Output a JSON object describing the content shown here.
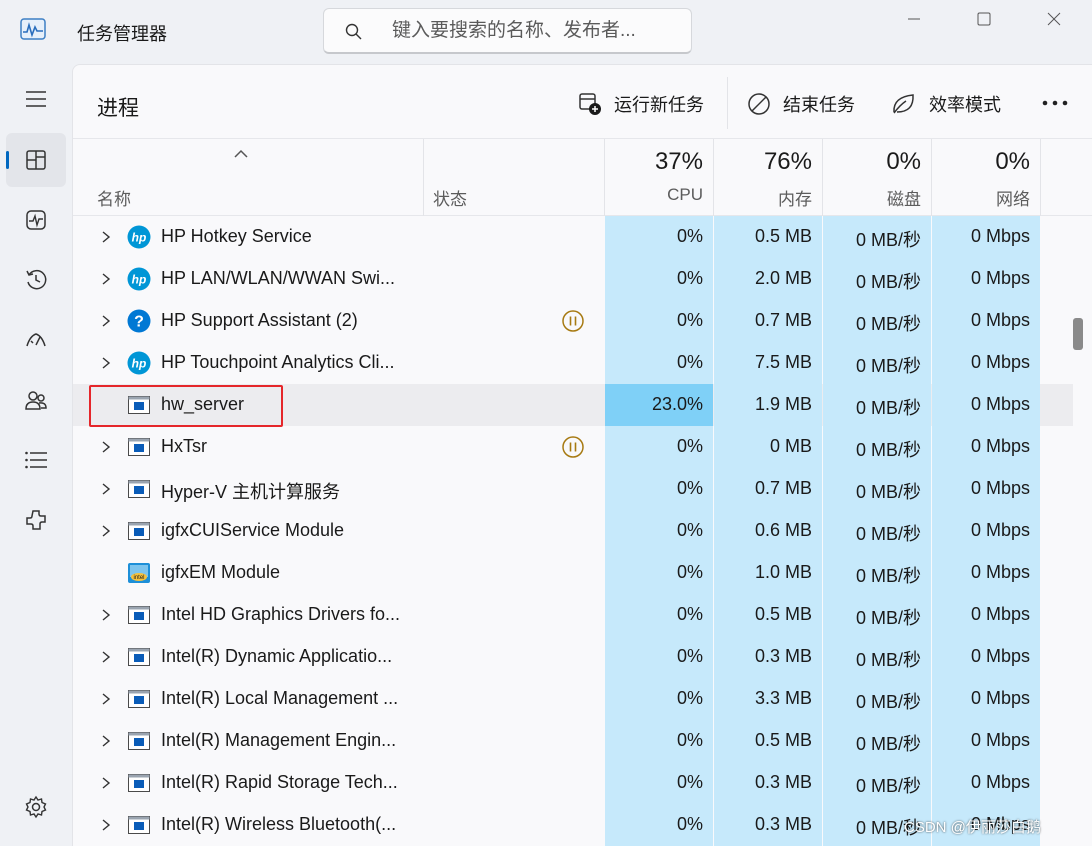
{
  "app": {
    "title": "任务管理器",
    "icon": "task-manager-icon"
  },
  "search": {
    "placeholder": "键入要搜索的名称、发布者..."
  },
  "window_controls": [
    "minimize-icon",
    "maximize-icon",
    "close-icon"
  ],
  "nav": [
    {
      "id": "menu",
      "icon": "hamburger-icon"
    },
    {
      "id": "processes",
      "icon": "processes-icon",
      "active": true
    },
    {
      "id": "performance",
      "icon": "performance-icon"
    },
    {
      "id": "app-history",
      "icon": "history-icon"
    },
    {
      "id": "startup",
      "icon": "startup-icon"
    },
    {
      "id": "users",
      "icon": "users-icon"
    },
    {
      "id": "details",
      "icon": "details-icon"
    },
    {
      "id": "services",
      "icon": "services-icon"
    },
    {
      "id": "settings",
      "icon": "settings-icon"
    }
  ],
  "page": {
    "title": "进程"
  },
  "commands": {
    "run_new_task": "运行新任务",
    "end_task": "结束任务",
    "efficiency_mode": "效率模式"
  },
  "columns": {
    "name": "名称",
    "status": "状态",
    "cpu": {
      "pct": "37%",
      "label": "CPU"
    },
    "memory": {
      "pct": "76%",
      "label": "内存"
    },
    "disk": {
      "pct": "0%",
      "label": "磁盘"
    },
    "network": {
      "pct": "0%",
      "label": "网络"
    }
  },
  "colors": {
    "metric_bg": "#c6e9fb",
    "metric_bg_hot": "#7fd0f7",
    "accent": "#0067c0",
    "highlight_border": "#e5262a"
  },
  "processes": [
    {
      "name": "HP Hotkey Service",
      "icon": "hp-logo-icon",
      "expandable": true,
      "status": "",
      "cpu": "0%",
      "memory": "0.5 MB",
      "disk": "0 MB/秒",
      "network": "0 Mbps"
    },
    {
      "name": "HP LAN/WLAN/WWAN Swi...",
      "icon": "hp-logo-icon",
      "expandable": true,
      "status": "",
      "cpu": "0%",
      "memory": "2.0 MB",
      "disk": "0 MB/秒",
      "network": "0 Mbps"
    },
    {
      "name": "HP Support Assistant (2)",
      "icon": "help-circle-icon",
      "expandable": true,
      "status": "paused",
      "cpu": "0%",
      "memory": "0.7 MB",
      "disk": "0 MB/秒",
      "network": "0 Mbps"
    },
    {
      "name": "HP Touchpoint Analytics Cli...",
      "icon": "hp-logo-icon",
      "expandable": true,
      "status": "",
      "cpu": "0%",
      "memory": "7.5 MB",
      "disk": "0 MB/秒",
      "network": "0 Mbps"
    },
    {
      "name": "hw_server",
      "icon": "app-window-icon",
      "expandable": false,
      "status": "",
      "cpu": "23.0%",
      "memory": "1.9 MB",
      "disk": "0 MB/秒",
      "network": "0 Mbps",
      "selected": true
    },
    {
      "name": "HxTsr",
      "icon": "app-window-icon",
      "expandable": true,
      "status": "paused",
      "cpu": "0%",
      "memory": "0 MB",
      "disk": "0 MB/秒",
      "network": "0 Mbps"
    },
    {
      "name": "Hyper-V 主机计算服务",
      "icon": "app-window-icon",
      "expandable": true,
      "status": "",
      "cpu": "0%",
      "memory": "0.7 MB",
      "disk": "0 MB/秒",
      "network": "0 Mbps"
    },
    {
      "name": "igfxCUIService Module",
      "icon": "app-window-icon",
      "expandable": true,
      "status": "",
      "cpu": "0%",
      "memory": "0.6 MB",
      "disk": "0 MB/秒",
      "network": "0 Mbps"
    },
    {
      "name": "igfxEM Module",
      "icon": "intel-graphics-icon",
      "expandable": false,
      "status": "",
      "cpu": "0%",
      "memory": "1.0 MB",
      "disk": "0 MB/秒",
      "network": "0 Mbps"
    },
    {
      "name": "Intel HD Graphics Drivers fo...",
      "icon": "app-window-icon",
      "expandable": true,
      "status": "",
      "cpu": "0%",
      "memory": "0.5 MB",
      "disk": "0 MB/秒",
      "network": "0 Mbps"
    },
    {
      "name": "Intel(R) Dynamic Applicatio...",
      "icon": "app-window-icon",
      "expandable": true,
      "status": "",
      "cpu": "0%",
      "memory": "0.3 MB",
      "disk": "0 MB/秒",
      "network": "0 Mbps"
    },
    {
      "name": "Intel(R) Local Management ...",
      "icon": "app-window-icon",
      "expandable": true,
      "status": "",
      "cpu": "0%",
      "memory": "3.3 MB",
      "disk": "0 MB/秒",
      "network": "0 Mbps"
    },
    {
      "name": "Intel(R) Management Engin...",
      "icon": "app-window-icon",
      "expandable": true,
      "status": "",
      "cpu": "0%",
      "memory": "0.5 MB",
      "disk": "0 MB/秒",
      "network": "0 Mbps"
    },
    {
      "name": "Intel(R) Rapid Storage Tech...",
      "icon": "app-window-icon",
      "expandable": true,
      "status": "",
      "cpu": "0%",
      "memory": "0.3 MB",
      "disk": "0 MB/秒",
      "network": "0 Mbps"
    },
    {
      "name": "Intel(R) Wireless Bluetooth(...",
      "icon": "app-window-icon",
      "expandable": true,
      "status": "",
      "cpu": "0%",
      "memory": "0.3 MB",
      "disk": "0 MB/秒",
      "network": "0 Mbps"
    }
  ],
  "watermark": "CSDN @伊丽莎白鹅"
}
